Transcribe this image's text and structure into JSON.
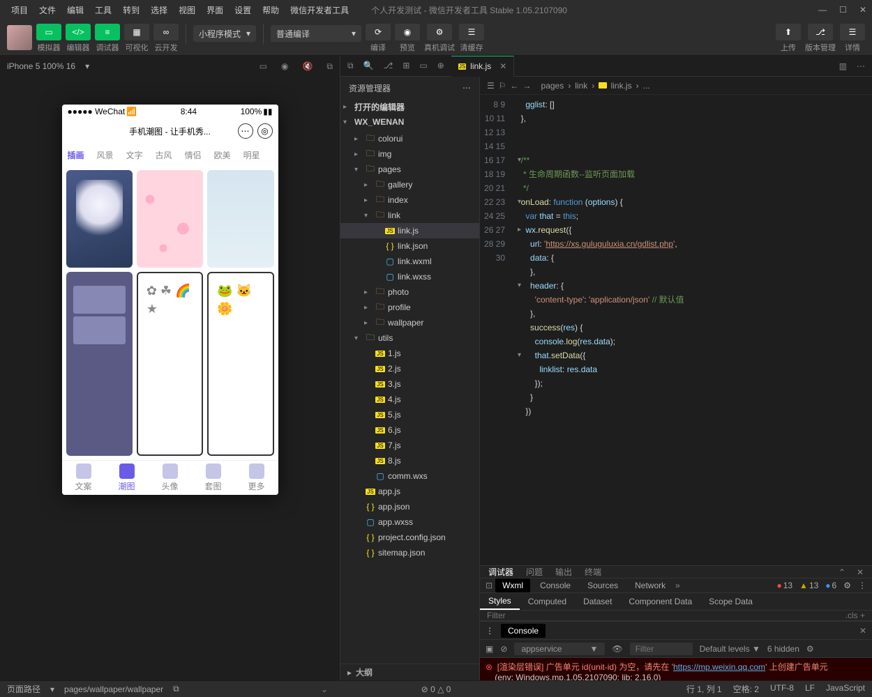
{
  "menubar": {
    "items": [
      "项目",
      "文件",
      "编辑",
      "工具",
      "转到",
      "选择",
      "视图",
      "界面",
      "设置",
      "帮助",
      "微信开发者工具"
    ],
    "title": "个人开发测试 - 微信开发者工具 Stable 1.05.2107090"
  },
  "toolbar": {
    "groups": [
      {
        "label": "模拟器"
      },
      {
        "label": "编辑器"
      },
      {
        "label": "调试器"
      },
      {
        "label": "可视化"
      },
      {
        "label": "云开发"
      }
    ],
    "combo1": "小程序模式",
    "combo2": "普通编译",
    "actions": [
      {
        "label": "编译"
      },
      {
        "label": "预览"
      },
      {
        "label": "真机调试"
      },
      {
        "label": "清缓存"
      }
    ],
    "right": [
      {
        "label": "上传"
      },
      {
        "label": "版本管理"
      },
      {
        "label": "详情"
      }
    ]
  },
  "simulator": {
    "device": "iPhone 5 100% 16"
  },
  "phone": {
    "status": {
      "carrier": "●●●●● WeChat",
      "wifi": "📶",
      "time": "8:44",
      "battery": "100%"
    },
    "title": "手机潮图 - 让手机秀...",
    "tabs": [
      "插画",
      "风景",
      "文字",
      "古风",
      "情侣",
      "欧美",
      "明星"
    ],
    "tabbar": [
      "文案",
      "潮图",
      "头像",
      "套图",
      "更多"
    ]
  },
  "explorer": {
    "title": "资源管理器",
    "sections": {
      "openEditors": "打开的编辑器",
      "project": "WX_WENAN",
      "outline": "大纲"
    },
    "tree": [
      {
        "d": 1,
        "chev": "▸",
        "ico": "folder",
        "name": "colorui"
      },
      {
        "d": 1,
        "chev": "▸",
        "ico": "folder",
        "name": "img",
        "green": true
      },
      {
        "d": 1,
        "chev": "▾",
        "ico": "folder",
        "name": "pages",
        "green": true
      },
      {
        "d": 2,
        "chev": "▸",
        "ico": "folder",
        "name": "gallery"
      },
      {
        "d": 2,
        "chev": "▸",
        "ico": "folder",
        "name": "index"
      },
      {
        "d": 2,
        "chev": "▾",
        "ico": "folder",
        "name": "link"
      },
      {
        "d": 3,
        "chev": "",
        "ico": "js",
        "name": "link.js",
        "sel": true
      },
      {
        "d": 3,
        "chev": "",
        "ico": "json",
        "name": "link.json"
      },
      {
        "d": 3,
        "chev": "",
        "ico": "wxml",
        "name": "link.wxml"
      },
      {
        "d": 3,
        "chev": "",
        "ico": "wxss",
        "name": "link.wxss"
      },
      {
        "d": 2,
        "chev": "▸",
        "ico": "folder",
        "name": "photo"
      },
      {
        "d": 2,
        "chev": "▸",
        "ico": "folder",
        "name": "profile"
      },
      {
        "d": 2,
        "chev": "▸",
        "ico": "folder",
        "name": "wallpaper"
      },
      {
        "d": 1,
        "chev": "▾",
        "ico": "folder",
        "name": "utils",
        "green": true
      },
      {
        "d": 2,
        "chev": "",
        "ico": "js",
        "name": "1.js"
      },
      {
        "d": 2,
        "chev": "",
        "ico": "js",
        "name": "2.js"
      },
      {
        "d": 2,
        "chev": "",
        "ico": "js",
        "name": "3.js"
      },
      {
        "d": 2,
        "chev": "",
        "ico": "js",
        "name": "4.js"
      },
      {
        "d": 2,
        "chev": "",
        "ico": "js",
        "name": "5.js"
      },
      {
        "d": 2,
        "chev": "",
        "ico": "js",
        "name": "6.js"
      },
      {
        "d": 2,
        "chev": "",
        "ico": "js",
        "name": "7.js"
      },
      {
        "d": 2,
        "chev": "",
        "ico": "js",
        "name": "8.js"
      },
      {
        "d": 2,
        "chev": "",
        "ico": "wxml",
        "name": "comm.wxs"
      },
      {
        "d": 1,
        "chev": "",
        "ico": "js",
        "name": "app.js"
      },
      {
        "d": 1,
        "chev": "",
        "ico": "json",
        "name": "app.json"
      },
      {
        "d": 1,
        "chev": "",
        "ico": "wxss",
        "name": "app.wxss"
      },
      {
        "d": 1,
        "chev": "",
        "ico": "json",
        "name": "project.config.json"
      },
      {
        "d": 1,
        "chev": "",
        "ico": "json",
        "name": "sitemap.json"
      }
    ]
  },
  "editor": {
    "tab": "link.js",
    "breadcrumb": [
      "pages",
      "link",
      "link.js",
      "..."
    ],
    "startLine": 8,
    "folds": {
      "12": "▾",
      "15": "▾",
      "17": "▸",
      "21": "▾",
      "26": "▾"
    },
    "lines": [
      "    <span class='c-prop'>gglist</span>: []",
      "  },",
      "",
      "",
      "  <span class='c-com'>/**</span>",
      "<span class='c-com'>   * 生命周期函数--监听页面加载</span>",
      "<span class='c-com'>   */</span>",
      "  <span class='c-fn'>onLoad</span>: <span class='c-key'>function</span> (<span class='c-prop'>options</span>) {",
      "    <span class='c-key'>var</span> <span class='c-prop'>that</span> = <span class='c-this'>this</span>;",
      "    <span class='c-prop'>wx</span>.<span class='c-fn'>request</span>({",
      "      <span class='c-prop'>url</span>: <span class='c-str'>'</span><span class='c-url'>https://xs.guluguluxia.cn/gdlist.php</span><span class='c-str'>'</span>,",
      "      <span class='c-prop'>data</span>: {",
      "      },",
      "      <span class='c-prop'>header</span>: {",
      "        <span class='c-str'>'content-type'</span>: <span class='c-str'>'application/json'</span> <span class='c-com'>// 默认值</span>",
      "      },",
      "      <span class='c-fn'>success</span>(<span class='c-prop'>res</span>) {",
      "        <span class='c-prop'>console</span>.<span class='c-fn'>log</span>(<span class='c-prop'>res</span>.<span class='c-prop'>data</span>);",
      "        <span class='c-prop'>that</span>.<span class='c-fn'>setData</span>({",
      "          <span class='c-prop'>linklist</span>: <span class='c-prop'>res</span>.<span class='c-prop'>data</span>",
      "        });",
      "      }",
      "    })"
    ]
  },
  "debugger": {
    "tabs": [
      "调试器",
      "问题",
      "输出",
      "终端"
    ],
    "devtabs": [
      "Wxml",
      "Console",
      "Sources",
      "Network"
    ],
    "badges": {
      "err": "13",
      "warn": "13",
      "info": "6"
    },
    "styleTabs": [
      "Styles",
      "Computed",
      "Dataset",
      "Component Data",
      "Scope Data"
    ],
    "filter": "Filter",
    "cls": ".cls"
  },
  "console": {
    "title": "Console",
    "context": "appservice",
    "filter": "Filter",
    "levels": "Default levels",
    "hidden": "6 hidden",
    "error": "[渲染层错误] 广告单元 id(unit-id) 为空，请先在 '",
    "errorLink": "https://mp.weixin.qq.com",
    "error2": "' 上创建广告单元",
    "env": "(env: Windows,mp,1.05.2107090; lib: 2.16.0)"
  },
  "statusbar": {
    "left": "页面路径",
    "path": "pages/wallpaper/wallpaper",
    "diag": "⊘ 0 △ 0",
    "right": [
      "行 1, 列 1",
      "空格: 2",
      "UTF-8",
      "LF",
      "JavaScript"
    ]
  }
}
